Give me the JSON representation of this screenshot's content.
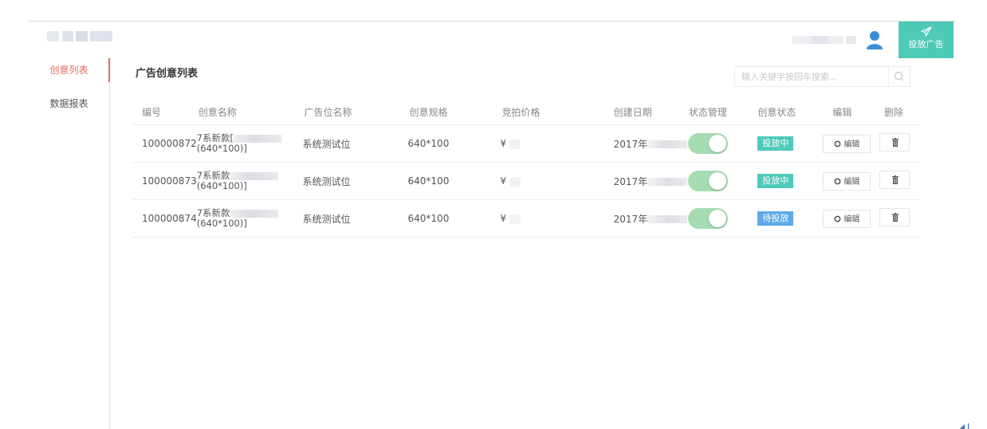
{
  "header": {
    "post_ad_label": "投放广告"
  },
  "sidebar": {
    "items": [
      {
        "label": "创意列表",
        "active": true
      },
      {
        "label": "数据报表",
        "active": false
      }
    ]
  },
  "main": {
    "title": "广告创意列表",
    "search": {
      "placeholder": "输入关键字按回车搜索...",
      "value": ""
    },
    "columns": [
      "编号",
      "创意名称",
      "广告位名称",
      "创意规格",
      "竞拍价格",
      "创建日期",
      "状态管理",
      "创意状态",
      "编辑",
      "删除"
    ],
    "rows": [
      {
        "id": "100000872",
        "name_line1": "7系新款[",
        "name_line2": "(640*100)]",
        "slot": "系统测试位",
        "spec": "640*100",
        "price": "¥",
        "date": "2017年",
        "toggle_on": true,
        "status": "投放中",
        "status_type": "live",
        "edit_label": "编辑"
      },
      {
        "id": "100000873",
        "name_line1": "7系新款",
        "name_line2": "(640*100)]",
        "slot": "系统测试位",
        "spec": "640*100",
        "price": "¥",
        "date": "2017年",
        "toggle_on": true,
        "status": "投放中",
        "status_type": "live",
        "edit_label": "编辑"
      },
      {
        "id": "100000874",
        "name_line1": "7系新款",
        "name_line2": "(640*100)]",
        "slot": "系统测试位",
        "spec": "640*100",
        "price": "¥",
        "date": "2017年",
        "toggle_on": true,
        "status": "待投放",
        "status_type": "wait",
        "edit_label": "编辑"
      }
    ]
  },
  "icons": {
    "user": "user-icon",
    "post": "paper-plane-icon",
    "search": "search-icon",
    "edit": "gear-icon",
    "delete": "trash-icon"
  },
  "colors": {
    "accent_teal": "#4fc9b8",
    "active_red": "#e96b5b",
    "user_blue": "#3a8fd6",
    "toggle_green": "#a5dcb2",
    "wait_blue": "#5ea9e6"
  }
}
